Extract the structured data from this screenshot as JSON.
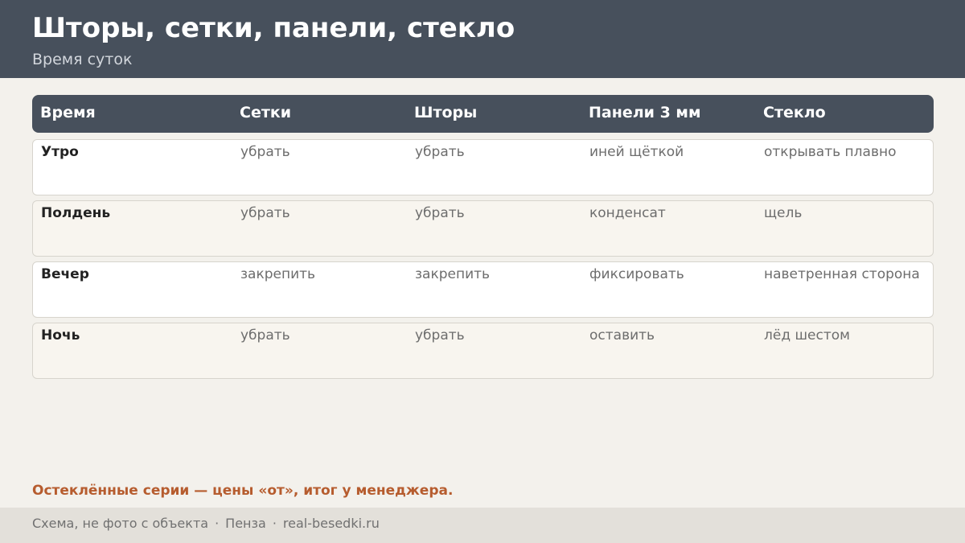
{
  "header": {
    "title": "Шторы, сетки, панели, стекло",
    "subtitle": "Время суток"
  },
  "table": {
    "columns": [
      "Время",
      "Сетки",
      "Шторы",
      "Панели 3 мм",
      "Стекло"
    ],
    "rows": [
      [
        "Утро",
        "убрать",
        "убрать",
        "иней щёткой",
        "открывать плавно"
      ],
      [
        "Полдень",
        "убрать",
        "убрать",
        "конденсат",
        "щель"
      ],
      [
        "Вечер",
        "закрепить",
        "закрепить",
        "фиксировать",
        "наветренная сторона"
      ],
      [
        "Ночь",
        "убрать",
        "убрать",
        "оставить",
        "лёд шестом"
      ]
    ]
  },
  "note": "Остеклённые серии — цены «от», итог у менеджера.",
  "footer": {
    "items": [
      "Схема, не фото с объекта",
      "Пенза",
      "real-besedki.ru"
    ],
    "separator": "·"
  },
  "colors": {
    "header_bg": "#47505c",
    "accent": "#b65c2e",
    "page_bg": "#f3f1ec"
  }
}
